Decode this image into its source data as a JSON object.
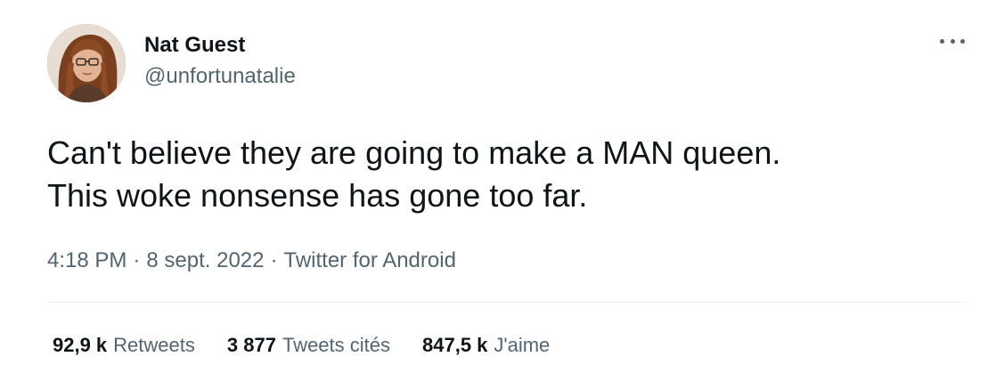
{
  "author": {
    "display_name": "Nat Guest",
    "handle": "@unfortunatalie"
  },
  "tweet": {
    "text_lines": [
      "Can't believe they are going to make a MAN queen.",
      "This woke nonsense has gone too far."
    ]
  },
  "meta": {
    "time": "4:18 PM",
    "separator": "·",
    "date": "8 sept. 2022",
    "source": "Twitter for Android"
  },
  "stats": {
    "retweets": {
      "count": "92,9 k",
      "label": "Retweets"
    },
    "quotes": {
      "count": "3 877",
      "label": "Tweets cités"
    },
    "likes": {
      "count": "847,5 k",
      "label": "J'aime"
    }
  },
  "icons": {
    "more": "more-horizontal-icon"
  },
  "colors": {
    "text_primary": "#0f1419",
    "text_secondary": "#536471",
    "divider": "#eff3f4"
  }
}
